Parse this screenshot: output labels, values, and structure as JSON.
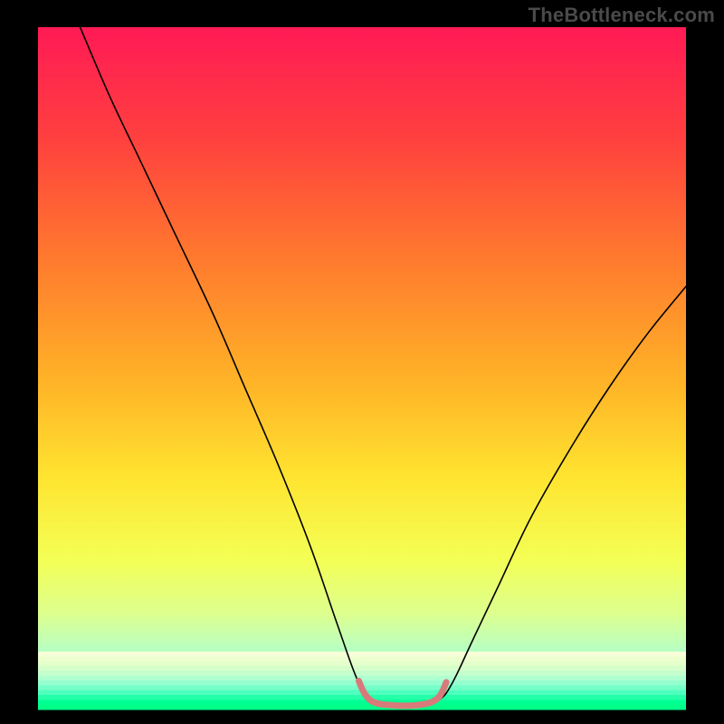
{
  "watermark": "TheBottleneck.com",
  "chart_data": {
    "type": "area",
    "title": "",
    "xlabel": "",
    "ylabel": "",
    "xlim": [
      0,
      100
    ],
    "ylim": [
      0,
      100
    ],
    "background_gradient_stops": [
      {
        "pct": 0,
        "color": "#ff1a55"
      },
      {
        "pct": 16,
        "color": "#ff3f3f"
      },
      {
        "pct": 34,
        "color": "#ff7a2e"
      },
      {
        "pct": 52,
        "color": "#ffb327"
      },
      {
        "pct": 66,
        "color": "#ffe430"
      },
      {
        "pct": 78,
        "color": "#f4ff55"
      },
      {
        "pct": 86,
        "color": "#ddff8f"
      },
      {
        "pct": 91,
        "color": "#baffc0"
      },
      {
        "pct": 95,
        "color": "#7affc8"
      },
      {
        "pct": 98,
        "color": "#32ffb0"
      },
      {
        "pct": 100,
        "color": "#00ff88"
      }
    ],
    "series": [
      {
        "name": "bottleneck-curve",
        "color": "#000000",
        "width": 1.6,
        "points": [
          {
            "x": 6.5,
            "y": 100
          },
          {
            "x": 11,
            "y": 90
          },
          {
            "x": 16,
            "y": 80
          },
          {
            "x": 21,
            "y": 70
          },
          {
            "x": 27,
            "y": 58
          },
          {
            "x": 32,
            "y": 47
          },
          {
            "x": 37,
            "y": 36
          },
          {
            "x": 42,
            "y": 24
          },
          {
            "x": 46,
            "y": 13
          },
          {
            "x": 49,
            "y": 5
          },
          {
            "x": 51,
            "y": 1.5
          },
          {
            "x": 55,
            "y": 0.8
          },
          {
            "x": 59,
            "y": 0.8
          },
          {
            "x": 62,
            "y": 1.5
          },
          {
            "x": 64,
            "y": 4
          },
          {
            "x": 67,
            "y": 10
          },
          {
            "x": 71,
            "y": 18
          },
          {
            "x": 76,
            "y": 28
          },
          {
            "x": 82,
            "y": 38
          },
          {
            "x": 88,
            "y": 47
          },
          {
            "x": 94,
            "y": 55
          },
          {
            "x": 100,
            "y": 62
          }
        ]
      },
      {
        "name": "bottom-marker",
        "color": "#d97a7a",
        "width": 7,
        "points": [
          {
            "x": 49.5,
            "y": 4.2
          },
          {
            "x": 50.5,
            "y": 2.2
          },
          {
            "x": 52,
            "y": 1.0
          },
          {
            "x": 55,
            "y": 0.6
          },
          {
            "x": 58,
            "y": 0.6
          },
          {
            "x": 60.5,
            "y": 1.0
          },
          {
            "x": 62,
            "y": 2.0
          },
          {
            "x": 63,
            "y": 4.0
          }
        ]
      }
    ],
    "bottom_stripes": [
      "#f6ffd8",
      "#eeffcf",
      "#e3ffca",
      "#d5ffca",
      "#c4ffcd",
      "#b0ffd0",
      "#95ffcf",
      "#75ffc9",
      "#4effbd",
      "#24ffa8",
      "#00ff93",
      "#00ff88"
    ]
  }
}
